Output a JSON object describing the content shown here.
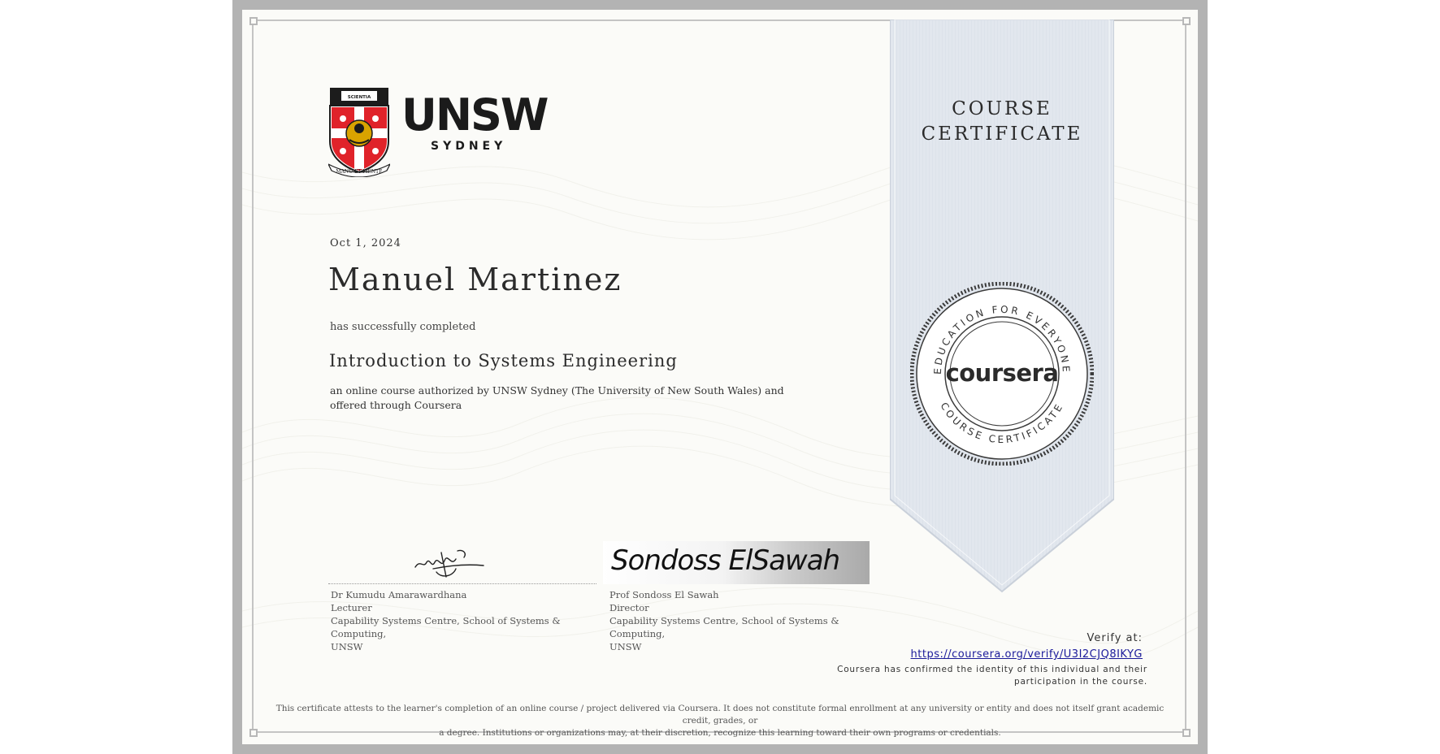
{
  "certificate": {
    "ribbon_title_line1": "COURSE",
    "ribbon_title_line2": "CERTIFICATE",
    "institution": {
      "name": "UNSW",
      "city": "SYDNEY",
      "motto": "MANU ET MENTE",
      "crest_banner": "SCIENTIA"
    },
    "date": "Oct 1, 2024",
    "recipient_name": "Manuel Martinez",
    "completed_text": "has successfully completed",
    "course_name": "Introduction to Systems Engineering",
    "description": "an online course authorized by UNSW Sydney (The University of New South Wales) and offered through Coursera",
    "seal": {
      "ring_top": "EDUCATION FOR EVERYONE",
      "ring_bottom": "COURSE CERTIFICATE",
      "brand": "coursera"
    },
    "signers": [
      {
        "name": "Dr Kumudu Amarawardhana",
        "title": "Lecturer",
        "department": "Capability Systems Centre, School of Systems & Computing,",
        "org": "UNSW"
      },
      {
        "name": "Prof Sondoss El Sawah",
        "title": "Director",
        "department": "Capability Systems Centre, School of Systems & Computing,",
        "org": "UNSW",
        "signature_text": "Sondoss ElSawah"
      }
    ],
    "verify_label": "Verify at:",
    "verify_url": "https://coursera.org/verify/U3I2CJQ8IKYG",
    "confirmation_line1": "Coursera has confirmed the identity of this individual and their",
    "confirmation_line2": "participation in the course.",
    "disclaimer_line1": "This certificate attests to the learner's completion of an online course / project delivered via Coursera. It does not constitute formal enrollment at any university or entity and does not itself grant academic credit, grades, or",
    "disclaimer_line2": "a degree. Institutions or organizations may, at their discretion, recognize this learning toward their own programs or credentials."
  },
  "colors": {
    "ribbon": "#e2e7ee",
    "ribbon_edge": "#c9d0da",
    "crest_red": "#e0232a",
    "crest_gold": "#d9a300",
    "link": "#1a1a9a"
  }
}
